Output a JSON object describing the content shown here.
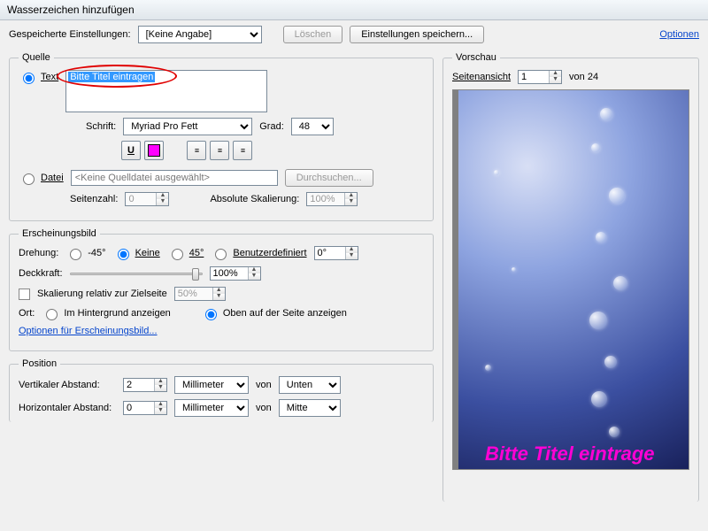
{
  "window": {
    "title": "Wasserzeichen hinzufügen"
  },
  "toolbar": {
    "saved_label": "Gespeicherte Einstellungen:",
    "saved_value": "[Keine Angabe]",
    "delete": "Löschen",
    "save_settings": "Einstellungen speichern...",
    "options": "Optionen"
  },
  "source": {
    "legend": "Quelle",
    "text_radio": "Text",
    "text_value": "Bitte Titel eintragen",
    "font_label": "Schrift:",
    "font_value": "Myriad Pro Fett",
    "size_label": "Grad:",
    "size_value": "48",
    "file_radio": "Datei",
    "file_value": "<Keine Quelldatei ausgewählt>",
    "browse": "Durchsuchen...",
    "page_label": "Seitenzahl:",
    "page_value": "0",
    "scale_label": "Absolute Skalierung:",
    "scale_value": "100%"
  },
  "appearance": {
    "legend": "Erscheinungsbild",
    "rotation_label": "Drehung:",
    "rot_m45": "-45°",
    "rot_none": "Keine",
    "rot_45": "45°",
    "rot_custom": "Benutzerdefiniert",
    "rot_custom_val": "0°",
    "opacity_label": "Deckkraft:",
    "opacity_value": "100%",
    "scale_rel_label": "Skalierung relativ zur Zielseite",
    "scale_rel_value": "50%",
    "loc_label": "Ort:",
    "loc_back": "Im Hintergrund anzeigen",
    "loc_front": "Oben auf der Seite anzeigen",
    "options_link": "Optionen für Erscheinungsbild..."
  },
  "position": {
    "legend": "Position",
    "vdist_label": "Vertikaler Abstand:",
    "vdist_value": "2",
    "hdist_label": "Horizontaler Abstand:",
    "hdist_value": "0",
    "unit": "Millimeter",
    "from": "von",
    "from_v": "Unten",
    "from_h": "Mitte"
  },
  "preview": {
    "legend": "Vorschau",
    "page_view": "Seitenansicht",
    "page_num": "1",
    "of": "von 24",
    "watermark_text": "Bitte Titel eintrage"
  }
}
